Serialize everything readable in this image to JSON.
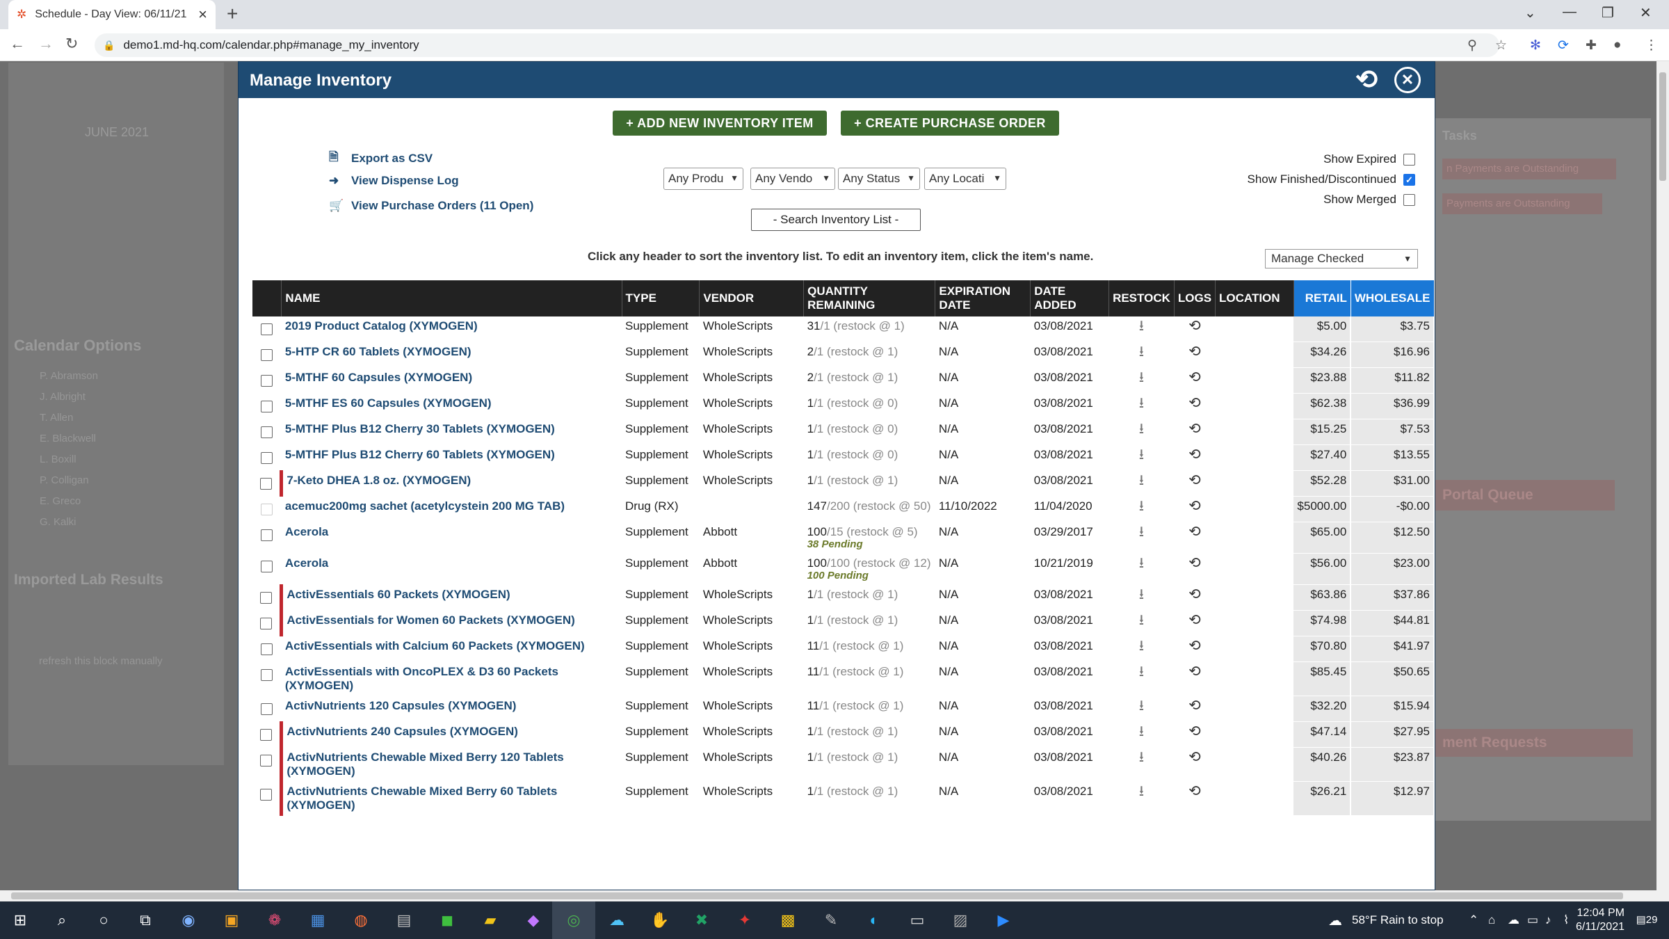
{
  "browser": {
    "tab_title": "Schedule - Day View: 06/11/21",
    "new_tab": "+",
    "url": "demo1.md-hq.com/calendar.php#manage_my_inventory"
  },
  "background": {
    "month": "JUNE 2021",
    "calendar_options": "Calendar Options",
    "imported_lab": "Imported Lab Results",
    "refresh_text": "refresh this block manually",
    "portal_queue": "Portal Queue",
    "requests": "ment Requests",
    "outstanding_1": "n Payments are Outstanding",
    "outstanding_2": "Payments are Outstanding",
    "tasks": "Tasks",
    "providers": [
      "P. Abramson",
      "J. Albright",
      "T. Allen",
      "E. Blackwell",
      "L. Boxill",
      "P. Colligan",
      "E. Greco",
      "G. Kalki"
    ]
  },
  "modal": {
    "title": "Manage Inventory",
    "add_button": "+ ADD NEW INVENTORY ITEM",
    "po_button": "+ CREATE PURCHASE ORDER",
    "links": {
      "export": "Export as CSV",
      "dispense": "View Dispense Log",
      "purchase_orders": "View Purchase Orders (11 Open)"
    },
    "filters": {
      "product": "Any Produ",
      "vendor": "Any Vendo",
      "status": "Any Status",
      "location": "Any Locati"
    },
    "search_button": "- Search Inventory List -",
    "show_expired": "Show Expired",
    "show_finished": "Show Finished/Discontinued",
    "show_merged": "Show Merged",
    "hint": "Click any header to sort the inventory list. To edit an inventory item, click the item's name.",
    "manage_checked": "Manage Checked"
  },
  "table": {
    "headers": {
      "name": "NAME",
      "type": "TYPE",
      "vendor": "VENDOR",
      "qty_1": "QUANTITY",
      "qty_2": "REMAINING",
      "exp_1": "EXPIRATION",
      "exp_2": "DATE",
      "added_1": "DATE",
      "added_2": "ADDED",
      "restock": "RESTOCK",
      "logs": "LOGS",
      "location": "LOCATION",
      "retail": "RETAIL",
      "wholesale": "WHOLESALE"
    },
    "rows": [
      {
        "name": "2019 Product Catalog (XYMOGEN)",
        "flag": false,
        "type": "Supplement",
        "vendor": "WholeScripts",
        "qty": "31",
        "qty_rest": "/1 (restock @ 1)",
        "pending": "",
        "exp": "N/A",
        "added": "03/08/2021",
        "retail": "$5.00",
        "wholesale": "$3.75",
        "dim_cb": false
      },
      {
        "name": "5-HTP CR 60 Tablets (XYMOGEN)",
        "flag": false,
        "type": "Supplement",
        "vendor": "WholeScripts",
        "qty": "2",
        "qty_rest": "/1 (restock @ 1)",
        "pending": "",
        "exp": "N/A",
        "added": "03/08/2021",
        "retail": "$34.26",
        "wholesale": "$16.96",
        "dim_cb": false
      },
      {
        "name": "5-MTHF 60 Capsules (XYMOGEN)",
        "flag": false,
        "type": "Supplement",
        "vendor": "WholeScripts",
        "qty": "2",
        "qty_rest": "/1 (restock @ 1)",
        "pending": "",
        "exp": "N/A",
        "added": "03/08/2021",
        "retail": "$23.88",
        "wholesale": "$11.82",
        "dim_cb": false
      },
      {
        "name": "5-MTHF ES 60 Capsules (XYMOGEN)",
        "flag": false,
        "type": "Supplement",
        "vendor": "WholeScripts",
        "qty": "1",
        "qty_rest": "/1 (restock @ 0)",
        "pending": "",
        "exp": "N/A",
        "added": "03/08/2021",
        "retail": "$62.38",
        "wholesale": "$36.99",
        "dim_cb": false
      },
      {
        "name": "5-MTHF Plus B12 Cherry 30 Tablets (XYMOGEN)",
        "flag": false,
        "type": "Supplement",
        "vendor": "WholeScripts",
        "qty": "1",
        "qty_rest": "/1 (restock @ 0)",
        "pending": "",
        "exp": "N/A",
        "added": "03/08/2021",
        "retail": "$15.25",
        "wholesale": "$7.53",
        "dim_cb": false
      },
      {
        "name": "5-MTHF Plus B12 Cherry 60 Tablets (XYMOGEN)",
        "flag": false,
        "type": "Supplement",
        "vendor": "WholeScripts",
        "qty": "1",
        "qty_rest": "/1 (restock @ 0)",
        "pending": "",
        "exp": "N/A",
        "added": "03/08/2021",
        "retail": "$27.40",
        "wholesale": "$13.55",
        "dim_cb": false
      },
      {
        "name": "7-Keto DHEA 1.8 oz. (XYMOGEN)",
        "flag": true,
        "type": "Supplement",
        "vendor": "WholeScripts",
        "qty": "1",
        "qty_rest": "/1 (restock @ 1)",
        "pending": "",
        "exp": "N/A",
        "added": "03/08/2021",
        "retail": "$52.28",
        "wholesale": "$31.00",
        "dim_cb": false
      },
      {
        "name": "acemuc200mg sachet (acetylcystein 200 MG TAB)",
        "flag": false,
        "type": "Drug (RX)",
        "vendor": "",
        "qty": "147",
        "qty_rest": "/200 (restock @ 50)",
        "pending": "",
        "exp": "11/10/2022",
        "added": "11/04/2020",
        "retail": "$5000.00",
        "wholesale": "-$0.00",
        "dim_cb": true
      },
      {
        "name": "Acerola",
        "flag": false,
        "type": "Supplement",
        "vendor": "Abbott",
        "qty": "100",
        "qty_rest": "/15 (restock @ 5)",
        "pending": "38 Pending",
        "exp": "N/A",
        "added": "03/29/2017",
        "retail": "$65.00",
        "wholesale": "$12.50",
        "dim_cb": false
      },
      {
        "name": "Acerola",
        "flag": false,
        "type": "Supplement",
        "vendor": "Abbott",
        "qty": "100",
        "qty_rest": "/100 (restock @ 12)",
        "pending": "100 Pending",
        "exp": "N/A",
        "added": "10/21/2019",
        "retail": "$56.00",
        "wholesale": "$23.00",
        "dim_cb": false
      },
      {
        "name": "ActivEssentials 60 Packets (XYMOGEN)",
        "flag": true,
        "type": "Supplement",
        "vendor": "WholeScripts",
        "qty": "1",
        "qty_rest": "/1 (restock @ 1)",
        "pending": "",
        "exp": "N/A",
        "added": "03/08/2021",
        "retail": "$63.86",
        "wholesale": "$37.86",
        "dim_cb": false
      },
      {
        "name": "ActivEssentials for Women 60 Packets (XYMOGEN)",
        "flag": true,
        "type": "Supplement",
        "vendor": "WholeScripts",
        "qty": "1",
        "qty_rest": "/1 (restock @ 1)",
        "pending": "",
        "exp": "N/A",
        "added": "03/08/2021",
        "retail": "$74.98",
        "wholesale": "$44.81",
        "dim_cb": false
      },
      {
        "name": "ActivEssentials with Calcium 60 Packets (XYMOGEN)",
        "flag": false,
        "type": "Supplement",
        "vendor": "WholeScripts",
        "qty": "11",
        "qty_rest": "/1 (restock @ 1)",
        "pending": "",
        "exp": "N/A",
        "added": "03/08/2021",
        "retail": "$70.80",
        "wholesale": "$41.97",
        "dim_cb": false
      },
      {
        "name": "ActivEssentials with OncoPLEX & D3 60 Packets (XYMOGEN)",
        "flag": false,
        "type": "Supplement",
        "vendor": "WholeScripts",
        "qty": "11",
        "qty_rest": "/1 (restock @ 1)",
        "pending": "",
        "exp": "N/A",
        "added": "03/08/2021",
        "retail": "$85.45",
        "wholesale": "$50.65",
        "dim_cb": false
      },
      {
        "name": "ActivNutrients 120 Capsules (XYMOGEN)",
        "flag": false,
        "type": "Supplement",
        "vendor": "WholeScripts",
        "qty": "11",
        "qty_rest": "/1 (restock @ 1)",
        "pending": "",
        "exp": "N/A",
        "added": "03/08/2021",
        "retail": "$32.20",
        "wholesale": "$15.94",
        "dim_cb": false
      },
      {
        "name": "ActivNutrients 240 Capsules (XYMOGEN)",
        "flag": true,
        "type": "Supplement",
        "vendor": "WholeScripts",
        "qty": "1",
        "qty_rest": "/1 (restock @ 1)",
        "pending": "",
        "exp": "N/A",
        "added": "03/08/2021",
        "retail": "$47.14",
        "wholesale": "$27.95",
        "dim_cb": false
      },
      {
        "name": "ActivNutrients Chewable Mixed Berry 120 Tablets (XYMOGEN)",
        "flag": true,
        "type": "Supplement",
        "vendor": "WholeScripts",
        "qty": "1",
        "qty_rest": "/1 (restock @ 1)",
        "pending": "",
        "exp": "N/A",
        "added": "03/08/2021",
        "retail": "$40.26",
        "wholesale": "$23.87",
        "dim_cb": false
      },
      {
        "name": "ActivNutrients Chewable Mixed Berry 60 Tablets (XYMOGEN)",
        "flag": true,
        "type": "Supplement",
        "vendor": "WholeScripts",
        "qty": "1",
        "qty_rest": "/1 (restock @ 1)",
        "pending": "",
        "exp": "N/A",
        "added": "03/08/2021",
        "retail": "$26.21",
        "wholesale": "$12.97",
        "dim_cb": false
      }
    ]
  },
  "taskbar": {
    "weather": "58°F  Rain to stop",
    "time": "12:04 PM",
    "date": "6/11/2021",
    "notifications": "29"
  },
  "colors": {
    "header_blue": "#1e4b73",
    "action_green": "#3e6b2f",
    "price_header": "#1a78d6",
    "flag_red": "#c0262d"
  }
}
